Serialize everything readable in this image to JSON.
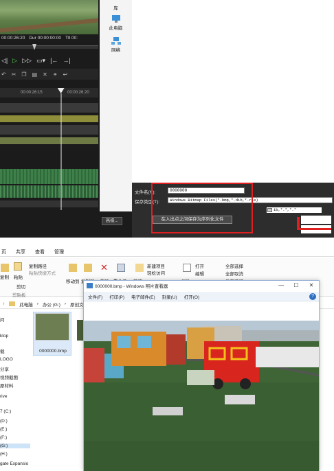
{
  "editor": {
    "timecode_cur": "00:00:26:20",
    "timecode_dur": "Dur 00:00:00:00",
    "timecode_ttl": "Ttl 00:",
    "ruler_tc1": "00:00:26:15",
    "ruler_tc2": "00:00:26:20",
    "transport_icons": [
      "prev-icon",
      "play-icon",
      "next-icon",
      "monitor-icon",
      "in-point-icon",
      "out-point-icon"
    ],
    "playhead_fraction": 0.62,
    "scrub_fraction": 0.35
  },
  "save_dialog": {
    "nav_items": [
      {
        "label": "库"
      },
      {
        "label": "此电脑"
      },
      {
        "label": "网络"
      }
    ],
    "filename_label": "文件名(N):",
    "filename_value": "0000000",
    "filetype_label": "保存类型(T):",
    "filetype_value": "Windows Bitmap Files(*.bmp,*.dib,*.rle)",
    "side_field_value": "ib,*.*,*.*",
    "save_sequence_button": "在入出点之间保存为序列化文件",
    "advanced_button": "高级...",
    "highlight_color": "#e02020"
  },
  "explorer": {
    "ribbon_tabs": [
      "页",
      "共享",
      "查看",
      "管理"
    ],
    "ribbon": {
      "copy_path": "复制路径",
      "paste_shortcut": "粘贴快捷方式",
      "copy": "复制",
      "paste": "粘贴",
      "cut": "剪切",
      "clipboard_group": "剪贴板",
      "move_to": "移动到",
      "copy_to": "复制到",
      "delete": "删除",
      "rename": "重命名",
      "new": "新建",
      "new_item": "新建项目",
      "easy_access": "轻松访问",
      "properties": "属性",
      "open": "打开",
      "edit": "编辑",
      "select_all": "全部选择",
      "select_none": "全部取消",
      "invert_selection": "反向选择"
    },
    "address": [
      "此电脑",
      "办公 (G:)",
      "原创文"
    ],
    "nav_pane": [
      "问",
      "ktop",
      "载",
      "LOGO",
      "分享",
      "视频截图",
      "原材料",
      "rive",
      "7 (C:)",
      "(D:)",
      "(E:)",
      "(F:)",
      "(G:)",
      "(H:)",
      "gate Expansio"
    ],
    "nav_selected_index": 12,
    "file_name": "0000000.bmp"
  },
  "viewer": {
    "title": "0000000.bmp - Windows 照片查看器",
    "menu": [
      "文件(F)",
      "打印(P)",
      "电子邮件(E)",
      "刻录(U)",
      "打开(O)"
    ],
    "help": "?",
    "controls": {
      "minimize": "—",
      "maximize": "☐",
      "close": "✕"
    },
    "brand_color": "#2f6fc2"
  }
}
